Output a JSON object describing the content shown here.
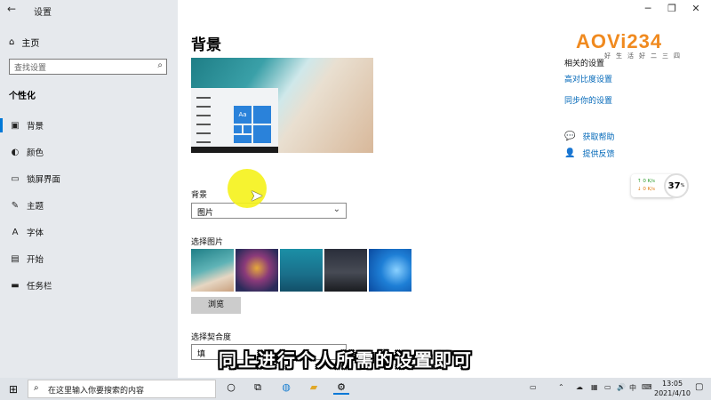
{
  "window": {
    "title": "设置",
    "back_icon": "arrow-left-icon",
    "controls": [
      "minimize",
      "maximize",
      "close"
    ]
  },
  "sidebar": {
    "home_label": "主页",
    "search_placeholder": "查找设置",
    "category": "个性化",
    "items": [
      {
        "label": "背景",
        "icon": "image-icon",
        "active": true
      },
      {
        "label": "颜色",
        "icon": "palette-icon"
      },
      {
        "label": "锁屏界面",
        "icon": "lock-screen-icon"
      },
      {
        "label": "主题",
        "icon": "brush-icon"
      },
      {
        "label": "字体",
        "icon": "font-icon"
      },
      {
        "label": "开始",
        "icon": "start-icon"
      },
      {
        "label": "任务栏",
        "icon": "taskbar-icon"
      }
    ]
  },
  "main": {
    "heading": "背景",
    "preview_tile_label": "Aa",
    "background_label": "背景",
    "background_value": "图片",
    "choose_picture_label": "选择图片",
    "browse_label": "浏览",
    "fit_label": "选择契合度",
    "fit_value": "填"
  },
  "related": {
    "title": "相关的设置",
    "links": [
      "高对比度设置",
      "同步你的设置"
    ],
    "help": [
      {
        "label": "获取帮助",
        "icon": "help-chat-icon"
      },
      {
        "label": "提供反馈",
        "icon": "feedback-icon"
      }
    ]
  },
  "overlay": {
    "logo": "AOVi234",
    "logo_sub": "好生活好二三四",
    "caption": "同上进行个人所需的设置即可",
    "speed_up": "0 K/s",
    "speed_down": "0 K/s",
    "gauge_value": "37",
    "gauge_unit": "%"
  },
  "taskbar": {
    "search_placeholder": "在这里输入你要搜索的内容",
    "time": "13:05",
    "date": "2021/4/10",
    "ime": "中"
  },
  "colors": {
    "accent": "#0078d7",
    "link": "#0067b8",
    "sidebar": "#e6e9ed",
    "highlight": "#f5f21a"
  }
}
